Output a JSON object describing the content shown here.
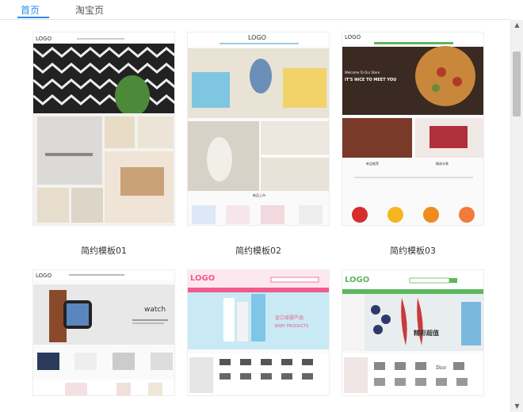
{
  "tabs": [
    {
      "label": "首页",
      "active": true
    },
    {
      "label": "淘宝页",
      "active": false
    }
  ],
  "templates": [
    {
      "caption": "简约模板01",
      "logo": "LOGO"
    },
    {
      "caption": "简约模板02",
      "logo": "LOGO",
      "section": "新品上市"
    },
    {
      "caption": "简约模板03",
      "logo": "LOGO",
      "hero_line1": "Welcome To Our Store",
      "hero_line2": "IT'S NICE TO MEET YOU",
      "section1": "新品推荐",
      "section2": "精选水果"
    },
    {
      "logo": "LOGO",
      "hero_text": "watch"
    },
    {
      "logo": "LOGO",
      "hero_line1": "金口母婴产品",
      "hero_line2": "BABY PRODUCTS"
    },
    {
      "logo": "LOGO",
      "hero_text": "精彩超值",
      "brand_dior": "Dior"
    }
  ],
  "colors": {
    "accent": "#2d8cf0",
    "pink": "#f05a8c",
    "green": "#5cb85c"
  }
}
